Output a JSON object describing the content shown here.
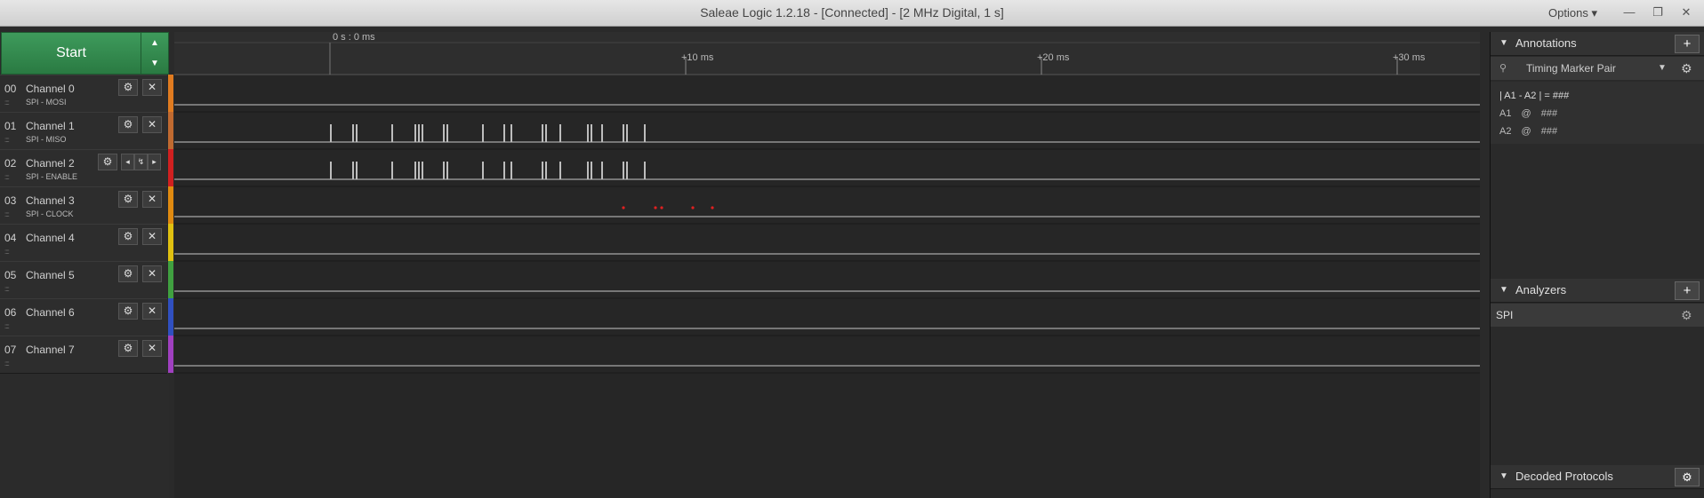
{
  "window": {
    "title": "Saleae Logic 1.2.18 - [Connected] - [2 MHz Digital, 1 s]",
    "options_label": "Options ▾",
    "minimize": "—",
    "restore": "❐",
    "close": "✕"
  },
  "capture": {
    "start_label": "Start",
    "up": "▲",
    "down": "▼"
  },
  "timeline": {
    "origin": "0 s : 0 ms",
    "ticks": [
      "+10 ms",
      "+20 ms",
      "+30 ms"
    ]
  },
  "channels": [
    {
      "num": "00",
      "name": "Channel 0",
      "sub": "SPI - MOSI",
      "color": "#e07b20"
    },
    {
      "num": "01",
      "name": "Channel 1",
      "sub": "SPI - MISO",
      "color": "#c06a30"
    },
    {
      "num": "02",
      "name": "Channel 2",
      "sub": "SPI - ENABLE",
      "color": "#d02020"
    },
    {
      "num": "03",
      "name": "Channel 3",
      "sub": "SPI - CLOCK",
      "color": "#e08a10"
    },
    {
      "num": "04",
      "name": "Channel 4",
      "sub": "",
      "color": "#e0c010"
    },
    {
      "num": "05",
      "name": "Channel 5",
      "sub": "",
      "color": "#40a040"
    },
    {
      "num": "06",
      "name": "Channel 6",
      "sub": "",
      "color": "#3050c0"
    },
    {
      "num": "07",
      "name": "Channel 7",
      "sub": "",
      "color": "#a040c0"
    }
  ],
  "icons": {
    "gear": "⚙",
    "close": "✕",
    "left": "◂",
    "edge": "↯",
    "right": "▸",
    "grip": "::::"
  },
  "annotations": {
    "header": "Annotations",
    "add": "+",
    "marker_pair": "Timing Marker Pair",
    "line1": "| A1 - A2 | = ###",
    "a1_label": "A1",
    "a2_label": "A2",
    "at": "@",
    "value": "###"
  },
  "analyzers": {
    "header": "Analyzers",
    "add": "+",
    "items": [
      "SPI"
    ]
  },
  "decoded": {
    "header": "Decoded Protocols"
  }
}
